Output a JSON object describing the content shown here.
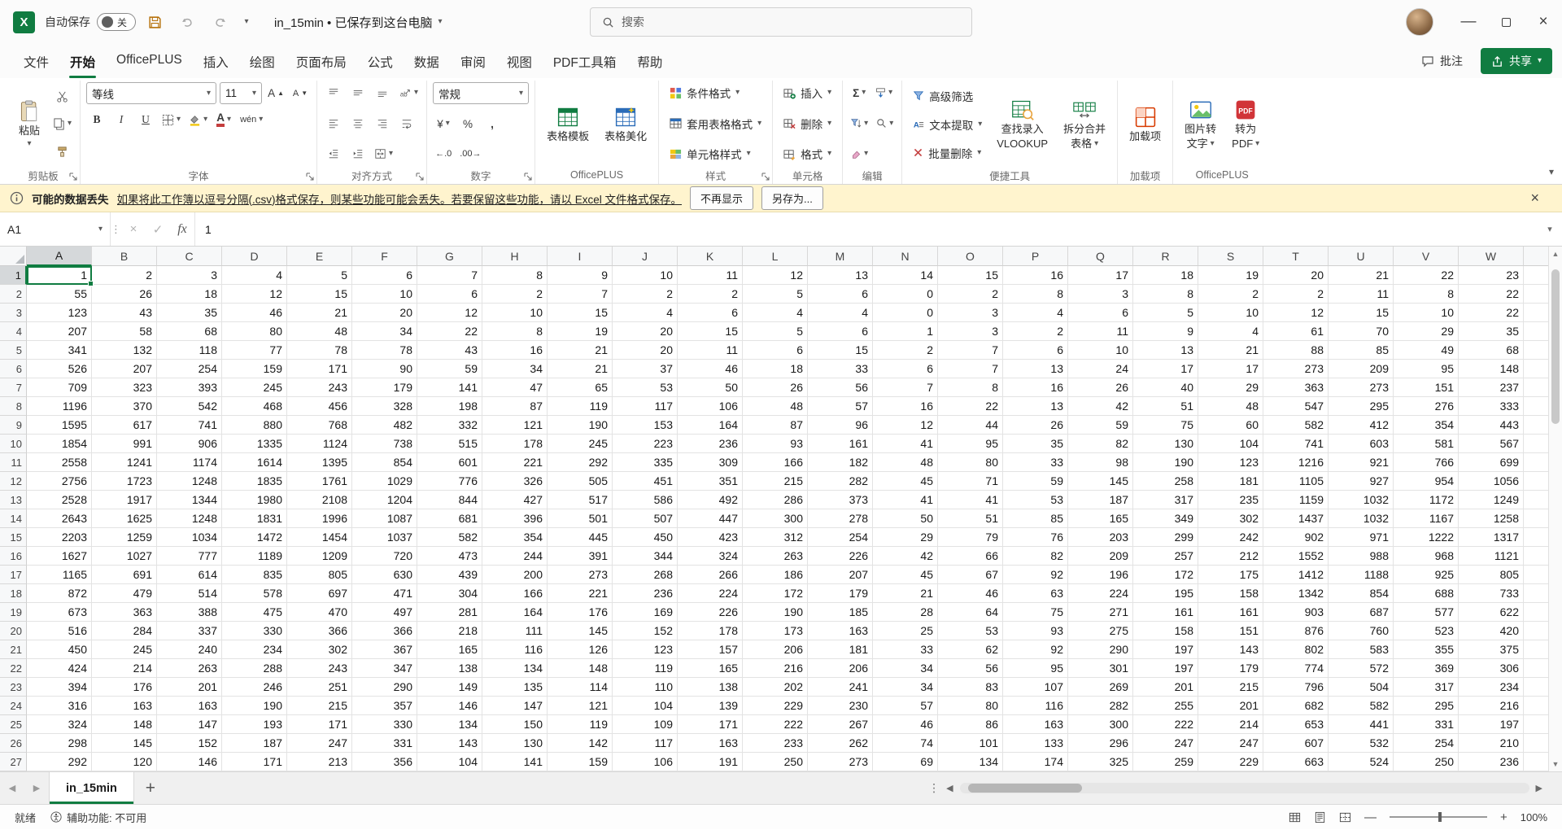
{
  "titlebar": {
    "autosave_label": "自动保存",
    "autosave_state": "关",
    "filename_full": "in_15min • 已保存到这台电脑",
    "search_placeholder": "搜索"
  },
  "ribbon_tabs": [
    {
      "id": "file",
      "label": "文件"
    },
    {
      "id": "home",
      "label": "开始",
      "active": true
    },
    {
      "id": "officeplus",
      "label": "OfficePLUS"
    },
    {
      "id": "insert",
      "label": "插入"
    },
    {
      "id": "draw",
      "label": "绘图"
    },
    {
      "id": "page-layout",
      "label": "页面布局"
    },
    {
      "id": "formulas",
      "label": "公式"
    },
    {
      "id": "data",
      "label": "数据"
    },
    {
      "id": "review",
      "label": "审阅"
    },
    {
      "id": "view",
      "label": "视图"
    },
    {
      "id": "pdf-toolbox",
      "label": "PDF工具箱"
    },
    {
      "id": "help",
      "label": "帮助"
    }
  ],
  "tab_actions": {
    "comments": "批注",
    "share": "共享"
  },
  "ribbon": {
    "clipboard": {
      "group": "剪贴板",
      "paste": "粘贴"
    },
    "font": {
      "group": "字体",
      "name": "等线",
      "size": "11",
      "bold": "B",
      "italic": "I",
      "underline": "U",
      "color_letter": "A",
      "fill_letter": "A",
      "pinyin": "wén",
      "grow": "A",
      "shrink": "A"
    },
    "alignment": {
      "group": "对齐方式",
      "orientation": "ab"
    },
    "number": {
      "group": "数字",
      "format": "常规",
      "currency": "¥",
      "percent": "%",
      "comma": ",",
      "inc_decimal": "←.0",
      "dec_decimal": ".00→"
    },
    "officeplus_group": {
      "group": "OfficePLUS",
      "template": "表格模板",
      "beautify": "表格美化"
    },
    "styles": {
      "group": "样式",
      "conditional": "条件格式",
      "table_format": "套用表格格式",
      "cell_styles": "单元格样式"
    },
    "cells": {
      "group": "单元格",
      "insert": "插入",
      "delete": "删除",
      "format": "格式"
    },
    "editing": {
      "group": "编辑",
      "sum": "Σ"
    },
    "tools": {
      "group": "便捷工具",
      "advanced_filter": "高级筛选",
      "text_extract": "文本提取",
      "batch_delete": "批量删除",
      "vlookup_line1": "查找录入",
      "vlookup_line2": "VLOOKUP",
      "split_line1": "拆分合并",
      "split_line2": "表格"
    },
    "addins": {
      "group": "加载项",
      "addin": "加载项"
    },
    "officeplus2": {
      "group": "OfficePLUS",
      "img_line1": "图片转",
      "img_line2": "文字",
      "pdf_line1": "转为",
      "pdf_line2": "PDF"
    }
  },
  "warning": {
    "title": "可能的数据丢失",
    "message": "如果将此工作簿以逗号分隔(.csv)格式保存，则某些功能可能会丢失。若要保留这些功能，请以 Excel 文件格式保存。",
    "dismiss": "不再显示",
    "save_as": "另存为..."
  },
  "formula_bar": {
    "name_box": "A1",
    "fx": "fx",
    "value": "1"
  },
  "grid": {
    "columns": [
      "A",
      "B",
      "C",
      "D",
      "E",
      "F",
      "G",
      "H",
      "I",
      "J",
      "K",
      "L",
      "M",
      "N",
      "O",
      "P",
      "Q",
      "R",
      "S",
      "T",
      "U",
      "V",
      "W"
    ],
    "selected_cell": "A1",
    "rows": [
      [
        1,
        2,
        3,
        4,
        5,
        6,
        7,
        8,
        9,
        10,
        11,
        12,
        13,
        14,
        15,
        16,
        17,
        18,
        19,
        20,
        21,
        22,
        23
      ],
      [
        55,
        26,
        18,
        12,
        15,
        10,
        6,
        2,
        7,
        2,
        2,
        5,
        6,
        0,
        2,
        8,
        3,
        8,
        2,
        2,
        11,
        8,
        22
      ],
      [
        123,
        43,
        35,
        46,
        21,
        20,
        12,
        10,
        15,
        4,
        6,
        4,
        4,
        0,
        3,
        4,
        6,
        5,
        10,
        12,
        15,
        10,
        22
      ],
      [
        207,
        58,
        68,
        80,
        48,
        34,
        22,
        8,
        19,
        20,
        15,
        5,
        6,
        1,
        3,
        2,
        11,
        9,
        4,
        61,
        70,
        29,
        35
      ],
      [
        341,
        132,
        118,
        77,
        78,
        78,
        43,
        16,
        21,
        20,
        11,
        6,
        15,
        2,
        7,
        6,
        10,
        13,
        21,
        88,
        85,
        49,
        68
      ],
      [
        526,
        207,
        254,
        159,
        171,
        90,
        59,
        34,
        21,
        37,
        46,
        18,
        33,
        6,
        7,
        13,
        24,
        17,
        17,
        273,
        209,
        95,
        148
      ],
      [
        709,
        323,
        393,
        245,
        243,
        179,
        141,
        47,
        65,
        53,
        50,
        26,
        56,
        7,
        8,
        16,
        26,
        40,
        29,
        363,
        273,
        151,
        237
      ],
      [
        1196,
        370,
        542,
        468,
        456,
        328,
        198,
        87,
        119,
        117,
        106,
        48,
        57,
        16,
        22,
        13,
        42,
        51,
        48,
        547,
        295,
        276,
        333
      ],
      [
        1595,
        617,
        741,
        880,
        768,
        482,
        332,
        121,
        190,
        153,
        164,
        87,
        96,
        12,
        44,
        26,
        59,
        75,
        60,
        582,
        412,
        354,
        443
      ],
      [
        1854,
        991,
        906,
        1335,
        1124,
        738,
        515,
        178,
        245,
        223,
        236,
        93,
        161,
        41,
        95,
        35,
        82,
        130,
        104,
        741,
        603,
        581,
        567
      ],
      [
        2558,
        1241,
        1174,
        1614,
        1395,
        854,
        601,
        221,
        292,
        335,
        309,
        166,
        182,
        48,
        80,
        33,
        98,
        190,
        123,
        1216,
        921,
        766,
        699
      ],
      [
        2756,
        1723,
        1248,
        1835,
        1761,
        1029,
        776,
        326,
        505,
        451,
        351,
        215,
        282,
        45,
        71,
        59,
        145,
        258,
        181,
        1105,
        927,
        954,
        1056
      ],
      [
        2528,
        1917,
        1344,
        1980,
        2108,
        1204,
        844,
        427,
        517,
        586,
        492,
        286,
        373,
        41,
        41,
        53,
        187,
        317,
        235,
        1159,
        1032,
        1172,
        1249
      ],
      [
        2643,
        1625,
        1248,
        1831,
        1996,
        1087,
        681,
        396,
        501,
        507,
        447,
        300,
        278,
        50,
        51,
        85,
        165,
        349,
        302,
        1437,
        1032,
        1167,
        1258
      ],
      [
        2203,
        1259,
        1034,
        1472,
        1454,
        1037,
        582,
        354,
        445,
        450,
        423,
        312,
        254,
        29,
        79,
        76,
        203,
        299,
        242,
        902,
        971,
        1222,
        1317
      ],
      [
        1627,
        1027,
        777,
        1189,
        1209,
        720,
        473,
        244,
        391,
        344,
        324,
        263,
        226,
        42,
        66,
        82,
        209,
        257,
        212,
        1552,
        988,
        968,
        1121
      ],
      [
        1165,
        691,
        614,
        835,
        805,
        630,
        439,
        200,
        273,
        268,
        266,
        186,
        207,
        45,
        67,
        92,
        196,
        172,
        175,
        1412,
        1188,
        925,
        805
      ],
      [
        872,
        479,
        514,
        578,
        697,
        471,
        304,
        166,
        221,
        236,
        224,
        172,
        179,
        21,
        46,
        63,
        224,
        195,
        158,
        1342,
        854,
        688,
        733
      ],
      [
        673,
        363,
        388,
        475,
        470,
        497,
        281,
        164,
        176,
        169,
        226,
        190,
        185,
        28,
        64,
        75,
        271,
        161,
        161,
        903,
        687,
        577,
        622
      ],
      [
        516,
        284,
        337,
        330,
        366,
        366,
        218,
        111,
        145,
        152,
        178,
        173,
        163,
        25,
        53,
        93,
        275,
        158,
        151,
        876,
        760,
        523,
        420
      ],
      [
        450,
        245,
        240,
        234,
        302,
        367,
        165,
        116,
        126,
        123,
        157,
        206,
        181,
        33,
        62,
        92,
        290,
        197,
        143,
        802,
        583,
        355,
        375
      ],
      [
        424,
        214,
        263,
        288,
        243,
        347,
        138,
        134,
        148,
        119,
        165,
        216,
        206,
        34,
        56,
        95,
        301,
        197,
        179,
        774,
        572,
        369,
        306
      ],
      [
        394,
        176,
        201,
        246,
        251,
        290,
        149,
        135,
        114,
        110,
        138,
        202,
        241,
        34,
        83,
        107,
        269,
        201,
        215,
        796,
        504,
        317,
        234
      ],
      [
        316,
        163,
        163,
        190,
        215,
        357,
        146,
        147,
        121,
        104,
        139,
        229,
        230,
        57,
        80,
        116,
        282,
        255,
        201,
        682,
        582,
        295,
        216
      ],
      [
        324,
        148,
        147,
        193,
        171,
        330,
        134,
        150,
        119,
        109,
        171,
        222,
        267,
        46,
        86,
        163,
        300,
        222,
        214,
        653,
        441,
        331,
        197
      ],
      [
        298,
        145,
        152,
        187,
        247,
        331,
        143,
        130,
        142,
        117,
        163,
        233,
        262,
        74,
        101,
        133,
        296,
        247,
        247,
        607,
        532,
        254,
        210
      ],
      [
        292,
        120,
        146,
        171,
        213,
        356,
        104,
        141,
        159,
        106,
        191,
        250,
        273,
        69,
        134,
        174,
        325,
        259,
        229,
        663,
        524,
        250,
        236
      ]
    ]
  },
  "sheet_bar": {
    "active_tab": "in_15min"
  },
  "status_bar": {
    "ready": "就绪",
    "accessibility": "辅助功能: 不可用",
    "zoom": "100%"
  },
  "colors": {
    "accent_green": "#107c41",
    "warning_bg": "#fff4ce"
  }
}
